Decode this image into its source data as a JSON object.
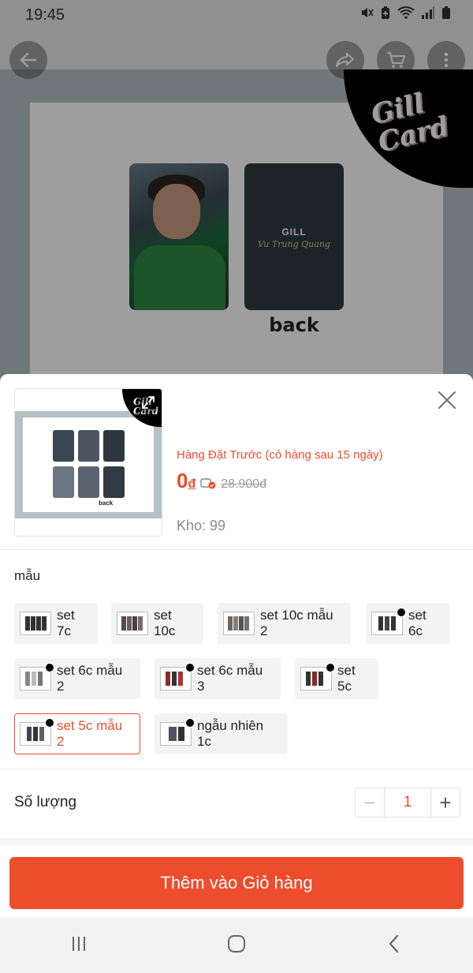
{
  "status_bar": {
    "time": "19:45",
    "icons": [
      "mute-icon",
      "battery-saver-icon",
      "wifi-icon",
      "signal-icon",
      "battery-icon"
    ]
  },
  "top_actions": [
    "back-arrow-icon",
    "share-icon",
    "cart-icon",
    "more-icon"
  ],
  "background_product": {
    "card_back_label": "back",
    "card_back_brand": "GILL",
    "card_back_signature": "Vu Trung Quang",
    "logo": "Gill Card"
  },
  "sheet": {
    "thumbnail_back_label": "back",
    "thumbnail_logo": "Gill Card",
    "preorder_text": "Hàng Đặt Trước (có hàng sau 15 ngày)",
    "price": "0",
    "currency": "đ",
    "original_price": "28.900đ",
    "stock": "Kho: 99",
    "variant_section_label": "mẫu",
    "variants": [
      {
        "label": "set 7c"
      },
      {
        "label": "set 10c"
      },
      {
        "label": "set 10c mẫu 2"
      },
      {
        "label": "set 6c"
      },
      {
        "label": "set 6c mẫu 2"
      },
      {
        "label": "set 6c mẫu 3"
      },
      {
        "label": "set 5c"
      },
      {
        "label": "set 5c mẫu 2"
      },
      {
        "label": "ngẫu nhiên 1c"
      }
    ],
    "selected_variant": "set 5c mẫu 2",
    "quantity_label": "Số lượng",
    "quantity_value": "1",
    "minus_symbol": "−",
    "plus_symbol": "+",
    "add_to_cart_label": "Thêm vào Giỏ hàng"
  },
  "colors": {
    "accent": "#ee4d2d",
    "muted_text": "#8a8a8a"
  },
  "nav_bar": [
    "recent-apps-icon",
    "home-icon",
    "back-icon"
  ]
}
